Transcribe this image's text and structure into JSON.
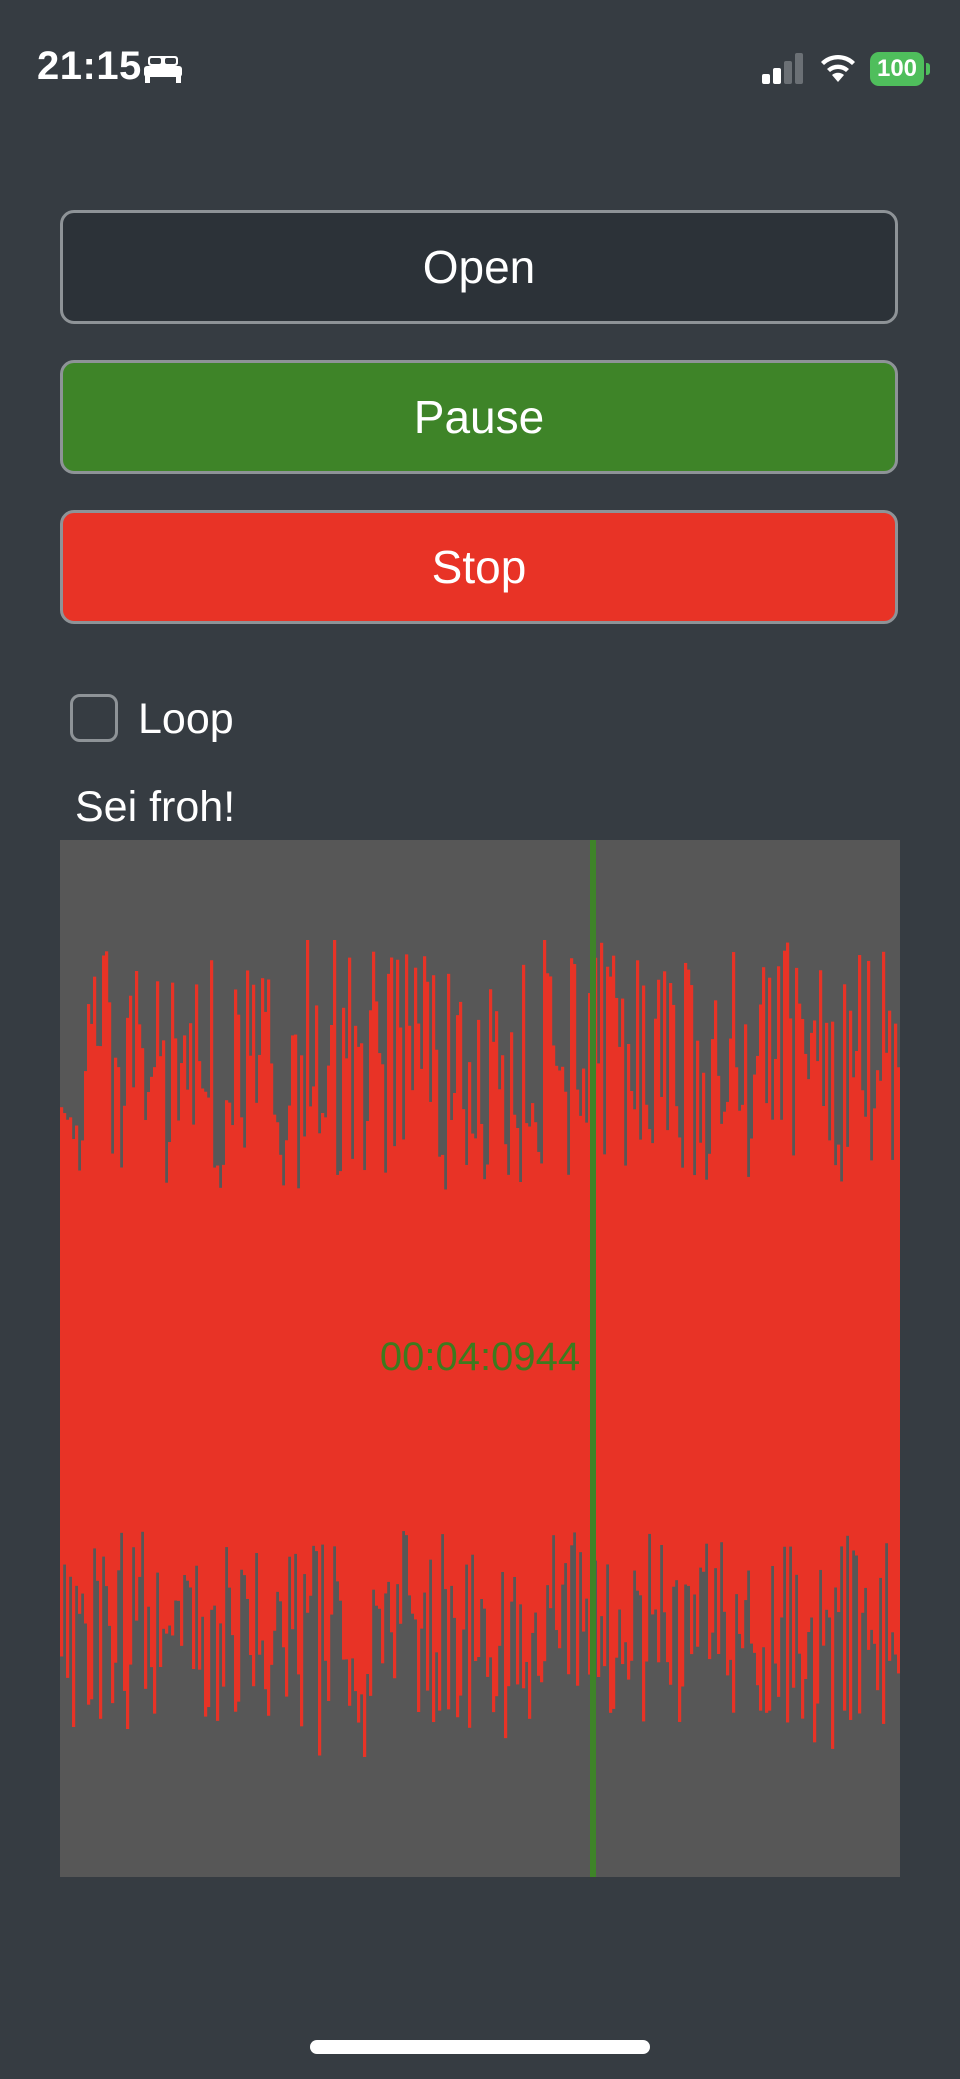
{
  "status_bar": {
    "time": "21:15",
    "focus_icon": "bed-icon",
    "battery_level": "100",
    "battery_color": "#4fbe5c",
    "signal_bars_active": 2,
    "signal_bars_total": 4
  },
  "controls": {
    "open_label": "Open",
    "pause_label": "Pause",
    "stop_label": "Stop",
    "pause_color": "#3e8428",
    "stop_color": "#e83326"
  },
  "loop": {
    "label": "Loop",
    "checked": false
  },
  "track": {
    "title": "Sei froh!"
  },
  "waveform": {
    "timecode": "00:04:0944",
    "wave_color": "#e83326",
    "background_color": "#575757",
    "playhead_color": "#3e8428",
    "playhead_position": 0.634
  }
}
